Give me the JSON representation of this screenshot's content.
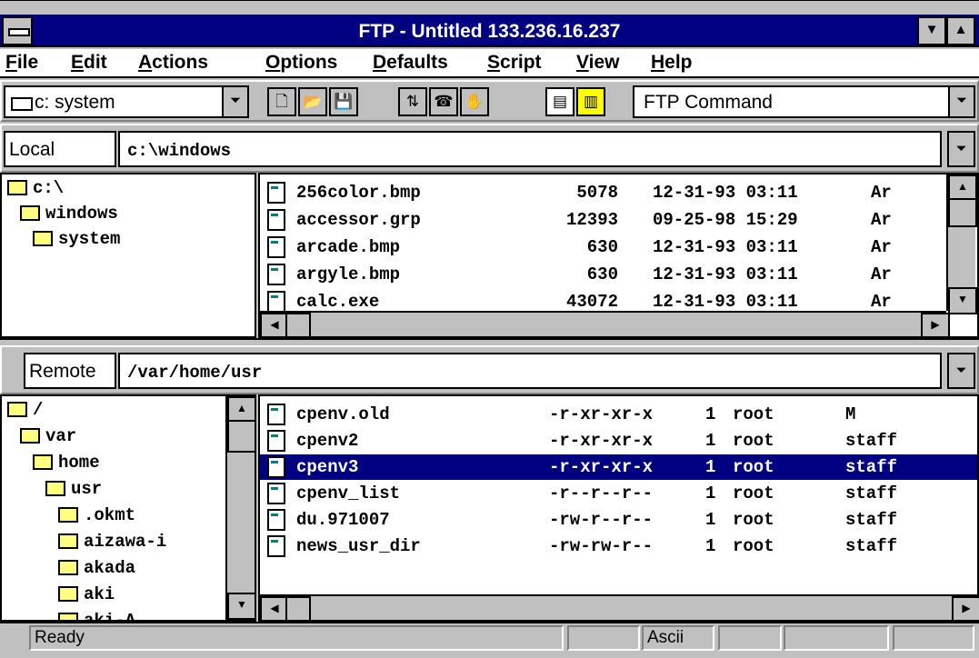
{
  "window": {
    "title": "FTP - Untitled 133.236.16.237",
    "system_menu_icon": "system-menu-icon",
    "minimize_icon": "minimize-icon",
    "maximize_icon": "maximize-icon"
  },
  "menu": {
    "file": "File",
    "edit": "Edit",
    "actions": "Actions",
    "options": "Options",
    "defaults": "Defaults",
    "script": "Script",
    "view": "View",
    "help": "Help"
  },
  "toolbar": {
    "drive_value": "c: system",
    "command_value": "FTP Command",
    "icons": [
      "new-icon",
      "open-icon",
      "save-icon",
      "transfer-icon",
      "connect-icon",
      "hand-icon",
      "binary-icon",
      "ascii-icon"
    ]
  },
  "local": {
    "label": "Local",
    "path": "c:\\windows",
    "tree": [
      {
        "name": "c:\\",
        "level": 0,
        "open": true
      },
      {
        "name": "windows",
        "level": 1,
        "open": true
      },
      {
        "name": "system",
        "level": 2,
        "open": false
      }
    ],
    "files": [
      {
        "name": "256color.bmp",
        "size": "5078",
        "date": "12-31-93 03:11",
        "attr": "Ar"
      },
      {
        "name": "accessor.grp",
        "size": "12393",
        "date": "09-25-98 15:29",
        "attr": "Ar"
      },
      {
        "name": "arcade.bmp",
        "size": "630",
        "date": "12-31-93 03:11",
        "attr": "Ar"
      },
      {
        "name": "argyle.bmp",
        "size": "630",
        "date": "12-31-93 03:11",
        "attr": "Ar"
      },
      {
        "name": "calc.exe",
        "size": "43072",
        "date": "12-31-93 03:11",
        "attr": "Ar"
      }
    ]
  },
  "remote": {
    "label": "Remote",
    "path": "/var/home/usr",
    "tree": [
      {
        "name": "/",
        "level": 0
      },
      {
        "name": "var",
        "level": 1
      },
      {
        "name": "home",
        "level": 2
      },
      {
        "name": "usr",
        "level": 3
      },
      {
        "name": ".okmt",
        "level": 4
      },
      {
        "name": "aizawa-i",
        "level": 4
      },
      {
        "name": "akada",
        "level": 4
      },
      {
        "name": "aki",
        "level": 4
      },
      {
        "name": "aki-A",
        "level": 4
      }
    ],
    "files": [
      {
        "name": "cpenv.old",
        "perm": "-r-xr-xr-x",
        "links": "1",
        "owner": "root",
        "group": "M",
        "selected": false
      },
      {
        "name": "cpenv2",
        "perm": "-r-xr-xr-x",
        "links": "1",
        "owner": "root",
        "group": "staff",
        "selected": false
      },
      {
        "name": "cpenv3",
        "perm": "-r-xr-xr-x",
        "links": "1",
        "owner": "root",
        "group": "staff",
        "selected": true
      },
      {
        "name": "cpenv_list",
        "perm": "-r--r--r--",
        "links": "1",
        "owner": "root",
        "group": "staff",
        "selected": false
      },
      {
        "name": "du.971007",
        "perm": "-rw-r--r--",
        "links": "1",
        "owner": "root",
        "group": "staff",
        "selected": false
      },
      {
        "name": "news_usr_dir",
        "perm": "-rw-rw-r--",
        "links": "1",
        "owner": "root",
        "group": "staff",
        "selected": false
      }
    ]
  },
  "status": {
    "message": "Ready",
    "mode": "Ascii"
  },
  "colors": {
    "title_bar": "#000080",
    "selection": "#000080",
    "face": "#c0c0c0"
  }
}
